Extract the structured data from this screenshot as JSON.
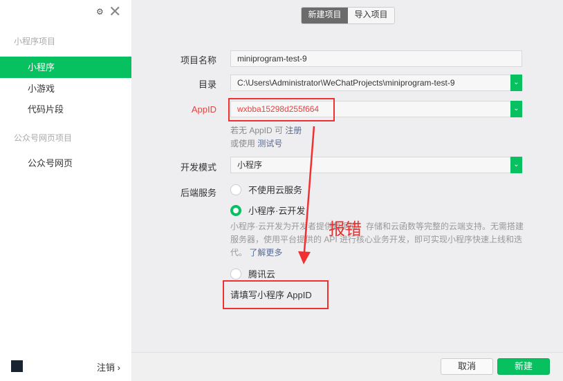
{
  "sidebar": {
    "section1": "小程序项目",
    "items1": [
      "小程序",
      "小游戏",
      "代码片段"
    ],
    "section2": "公众号网页项目",
    "items2": [
      "公众号网页"
    ],
    "logout": "注销 ›",
    "settings_icon": "⚙",
    "close_icon": "✕"
  },
  "tabs": [
    "新建项目",
    "导入项目"
  ],
  "form": {
    "name_label": "项目名称",
    "name_value": "miniprogram-test-9",
    "dir_label": "目录",
    "dir_value": "C:\\Users\\Administrator\\WeChatProjects\\miniprogram-test-9",
    "appid_label": "AppID",
    "appid_value": "wxbba15298d255f664",
    "hint1": "若无 AppID 可",
    "hint1_link": "注册",
    "hint2": "或使用",
    "hint2_link": "测试号",
    "mode_label": "开发模式",
    "mode_value": "小程序",
    "backend_label": "后端服务",
    "radios": [
      "不使用云服务",
      "小程序·云开发",
      "腾讯云"
    ],
    "desc": "小程序·云开发为开发者提供数据库、存储和云函数等完整的云端支持。无需搭建服务器，使用平台提供的 API 进行核心业务开发，即可实现小程序快速上线和迭代。",
    "desc_link": "了解更多",
    "error": "请填写小程序 AppID"
  },
  "annotation": "报错",
  "footer": {
    "cancel": "取消",
    "create": "新建"
  }
}
